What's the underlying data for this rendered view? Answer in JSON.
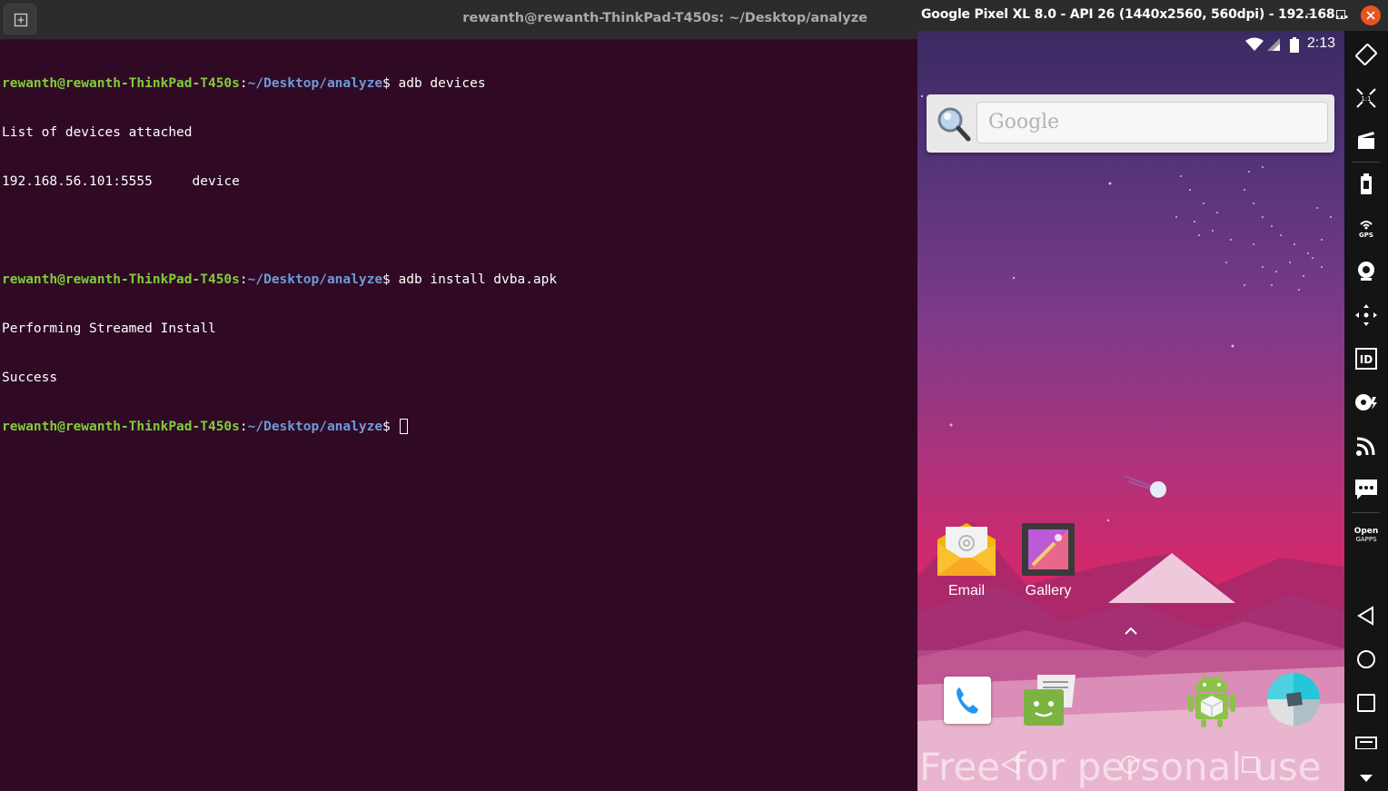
{
  "terminal": {
    "title": "rewanth@rewanth-ThinkPad-T450s: ~/Desktop/analyze",
    "user_host": "rewanth@rewanth-ThinkPad-T450s",
    "colon": ":",
    "path": "~/Desktop/analyze",
    "dollar": "$ ",
    "cmd1": "adb devices",
    "out1": "List of devices attached",
    "out2": "192.168.56.101:5555\tdevice",
    "cmd2": "adb install dvba.apk",
    "out3": "Performing Streamed Install",
    "out4": "Success"
  },
  "emulator": {
    "title": "Google Pixel XL 8.0 - API 26 (1440x2560, 560dpi) - 192.168...",
    "minimize": "–",
    "status_time": "2:13",
    "search_placeholder": "Google",
    "apps": [
      {
        "label": "Email",
        "icon": "email-icon"
      },
      {
        "label": "Gallery",
        "icon": "gallery-icon"
      }
    ],
    "dock": [
      "phone-icon",
      "messaging-icon",
      "android-app-icon",
      "camera-icon"
    ],
    "watermark": "Free for personal use",
    "toolbar": [
      "rotate-icon",
      "scale-icon",
      "screenshot-icon",
      "battery-icon",
      "gps-icon",
      "camera-icon",
      "move-icon",
      "identifiers-icon",
      "disk-icon",
      "network-icon",
      "sms-icon",
      "open-gapps-icon",
      "back-icon",
      "home-icon",
      "recents-icon",
      "menu-icon",
      "more-icon"
    ],
    "toolbar_gps": "GPS",
    "toolbar_id": "ID",
    "toolbar_opengapps_1": "Open",
    "toolbar_opengapps_2": "GAPPS"
  },
  "colors": {
    "terminal_bg": "#300a24",
    "user_green": "#7fcc3a",
    "path_blue": "#6c9bd9",
    "close_orange": "#e95420"
  }
}
